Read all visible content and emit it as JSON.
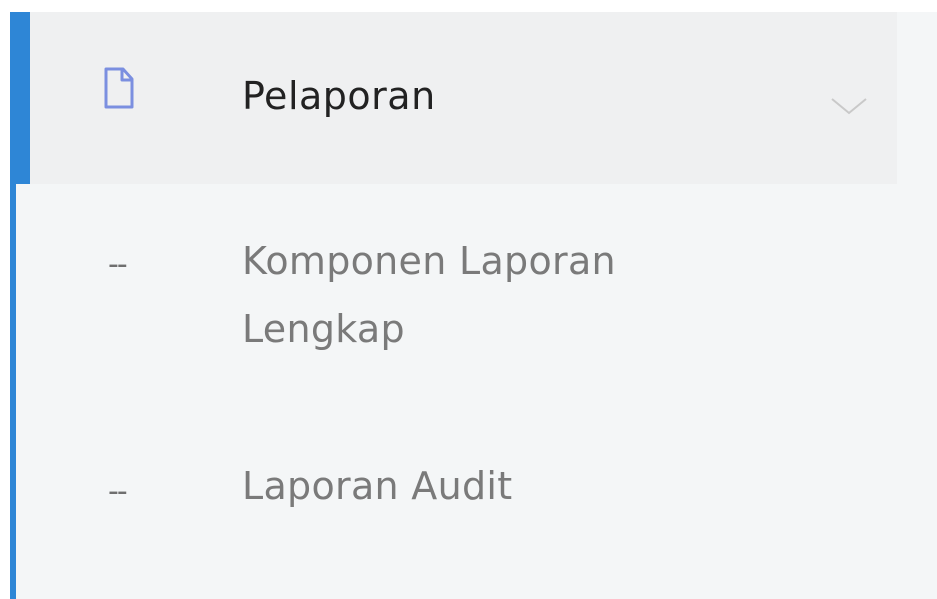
{
  "menu": {
    "header": {
      "label": "Pelaporan",
      "icon": "document-icon",
      "expanded": true
    },
    "items": [
      {
        "dash": "--",
        "label": "Komponen Laporan Lengkap"
      },
      {
        "dash": "--",
        "label": "Laporan Audit"
      }
    ]
  },
  "colors": {
    "accent": "#2e86d6",
    "header_bg": "#eff0f1",
    "submenu_bg": "#f4f6f7",
    "header_text": "#222222",
    "submenu_text": "#7a7a7a",
    "icon": "#7b8fe0"
  }
}
